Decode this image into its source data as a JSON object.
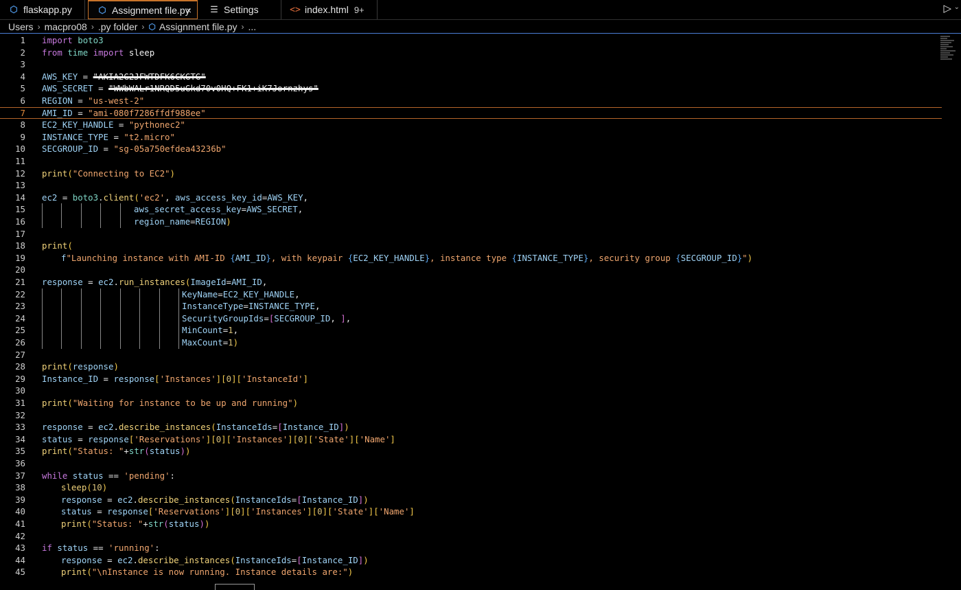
{
  "tabs": [
    {
      "label": "flaskapp.py",
      "icon": "python-file-icon"
    },
    {
      "label": "Assignment file.py",
      "icon": "python-file-icon",
      "active": true,
      "close": "×"
    },
    {
      "label": "Settings",
      "icon": "settings-icon"
    },
    {
      "label": "index.html",
      "icon": "html-file-icon",
      "badge": "9+"
    }
  ],
  "run_icon": "run-icon",
  "breadcrumb": [
    "Users",
    "macpro08",
    ".py folder",
    "Assignment file.py",
    "..."
  ],
  "line_numbers": [
    "1",
    "2",
    "3",
    "4",
    "5",
    "6",
    "7",
    "8",
    "9",
    "10",
    "11",
    "12",
    "13",
    "14",
    "15",
    "16",
    "17",
    "18",
    "19",
    "20",
    "21",
    "22",
    "23",
    "24",
    "25",
    "26",
    "27",
    "28",
    "29",
    "30",
    "31",
    "32",
    "33",
    "34",
    "35",
    "36",
    "37",
    "38",
    "39",
    "40",
    "41",
    "42",
    "43",
    "44",
    "45"
  ],
  "code": {
    "import": "import",
    "from": "from",
    "boto3": "boto3",
    "time": "time",
    "sleep": "sleep",
    "AWS_KEY": "AWS_KEY",
    "eq": " = ",
    "aws_key_val": "\"AKIA2G2JFWTDFK6CKGTG\"",
    "AWS_SECRET": "AWS_SECRET",
    "aws_secret_val": "\"WWbWALr1NRQD5uGkd70v0HQ+FK1+iK7Jornzhys\"",
    "REGION": "REGION",
    "region_val": "\"us-west-2\"",
    "AMI_ID": "AMI_ID",
    "ami_val": "\"ami-080f7286ffdf988ee\"",
    "EC2_KEY_HANDLE": "EC2_KEY_HANDLE",
    "key_val": "\"pythonec2\"",
    "INSTANCE_TYPE": "INSTANCE_TYPE",
    "type_val": "\"t2.micro\"",
    "SECGROUP_ID": "SECGROUP_ID",
    "sg_val": "\"sg-05a750efdea43236b\"",
    "print": "print",
    "connecting": "\"Connecting to EC2\"",
    "ec2": "ec2",
    "client": "client",
    "ec2_str": "'ec2'",
    "aws_access_key_id": "aws_access_key_id",
    "aws_secret_access_key": "aws_secret_access_key",
    "region_name": "region_name",
    "fprefix": "f",
    "launch_1": "\"Launching instance with AMI-ID ",
    "launch_2": ", with keypair ",
    "launch_3": ", instance type ",
    "launch_4": ", security group ",
    "launch_5": "\"",
    "response": "response",
    "run_instances": "run_instances",
    "ImageId": "ImageId",
    "KeyName": "KeyName",
    "InstanceType": "InstanceType",
    "SecurityGroupIds": "SecurityGroupIds",
    "MinCount": "MinCount",
    "MaxCount": "MaxCount",
    "one": "1",
    "Instance_ID": "Instance_ID",
    "instances_str": "'Instances'",
    "zero": "0",
    "instanceid_str": "'InstanceId'",
    "waiting": "\"Waiting for instance to be up and running\"",
    "describe_instances": "describe_instances",
    "InstanceIds": "InstanceIds",
    "status": "status",
    "reservations_str": "'Reservations'",
    "state_str": "'State'",
    "name_str": "'Name'",
    "status_str": "\"Status: \"",
    "str": "str",
    "while": "while",
    "pending_str": "'pending'",
    "ten": "10",
    "if": "if",
    "running_str": "'running'",
    "running_msg": "\"\\nInstance is now running. Instance details are:\"",
    "eqeq": " == "
  }
}
